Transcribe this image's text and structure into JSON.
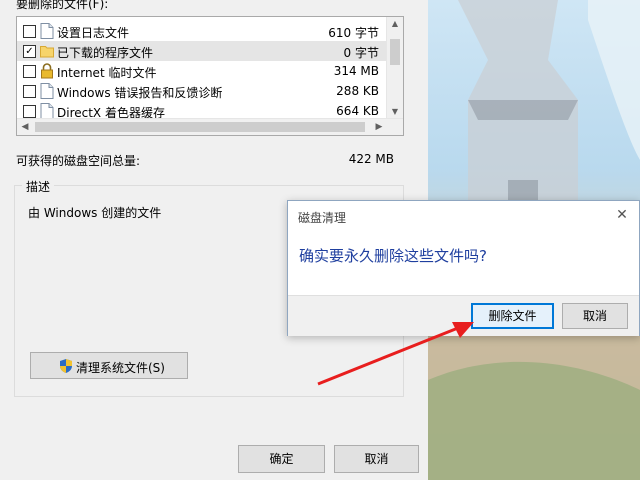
{
  "main": {
    "list_header": "要删除的文件(F):",
    "files": [
      {
        "name": "设置日志文件",
        "size": "610 字节",
        "checked": false,
        "icon": "document-icon"
      },
      {
        "name": "已下载的程序文件",
        "size": "0 字节",
        "checked": true,
        "icon": "folder-icon"
      },
      {
        "name": "Internet 临时文件",
        "size": "314 MB",
        "checked": false,
        "icon": "lock-icon"
      },
      {
        "name": "Windows 错误报告和反馈诊断",
        "size": "288 KB",
        "checked": false,
        "icon": "document-icon"
      },
      {
        "name": "DirectX 着色器缓存",
        "size": "664 KB",
        "checked": false,
        "icon": "document-icon"
      }
    ],
    "total_label": "可获得的磁盘空间总量:",
    "total_value": "422 MB",
    "desc_legend": "描述",
    "desc_text": "由 Windows 创建的文件",
    "cleanup_button": "清理系统文件(S)",
    "ok_button": "确定",
    "cancel_button": "取消"
  },
  "dialog": {
    "title": "磁盘清理",
    "message": "确实要永久删除这些文件吗?",
    "delete_button": "删除文件",
    "cancel_button": "取消"
  },
  "colors": {
    "accent": "#0078d7",
    "message": "#1f3f9f",
    "annotation_arrow": "#e81e1e"
  }
}
